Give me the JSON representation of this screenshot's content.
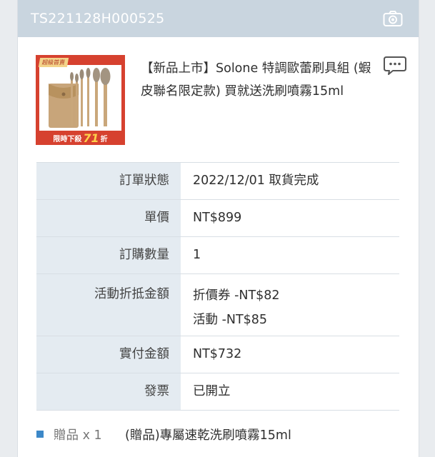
{
  "order": {
    "id": "TS221128H000525"
  },
  "product": {
    "title": "【新品上市】Solone 特調歐蕾刷具組 (蝦皮聯名限定款) 買就送洗刷噴霧15ml",
    "thumbnail": {
      "tag": "超級首賣",
      "banner_prefix": "限時下殺",
      "banner_discount": "71",
      "banner_suffix": "折"
    }
  },
  "details": [
    {
      "label": "訂單狀態",
      "value": "2022/12/01 取貨完成"
    },
    {
      "label": "單價",
      "value": "NT$899"
    },
    {
      "label": "訂購數量",
      "value": "1"
    },
    {
      "label": "活動折抵金額",
      "lines": [
        "折價券 -NT$82",
        "活動 -NT$85"
      ]
    },
    {
      "label": "實付金額",
      "value": "NT$732"
    },
    {
      "label": "發票",
      "value": "已開立"
    }
  ],
  "gift": {
    "label": "贈品 x 1",
    "text": "(贈品)專屬速乾洗刷噴霧15ml"
  },
  "colors": {
    "header_bg": "#c9d5df",
    "label_bg": "#e4ebf1",
    "link": "#2e7fc1",
    "thumb_red": "#d6412f",
    "gift_marker": "#3c88c8"
  },
  "icons": {
    "header_right": "camera-icon",
    "product_right": "chat-icon"
  }
}
